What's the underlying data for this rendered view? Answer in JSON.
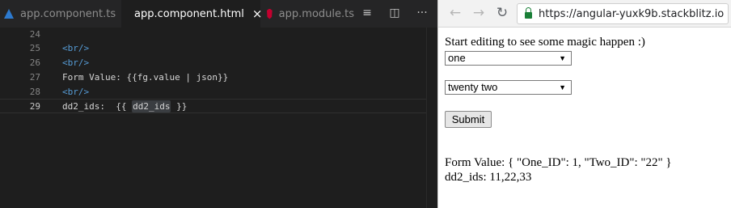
{
  "editor": {
    "tabs": [
      {
        "label": "app.component.ts",
        "icon": "typescript-icon"
      },
      {
        "label": "app.component.html",
        "icon": "html5-icon",
        "close": "×"
      },
      {
        "label": "app.module.ts",
        "icon": "angular-icon"
      }
    ],
    "toolbar": {
      "format_icon": "≡",
      "split_icon": "◫",
      "more_icon": "···"
    },
    "lines": [
      {
        "num": "24",
        "text": ""
      },
      {
        "num": "25",
        "text": "<br/>"
      },
      {
        "num": "26",
        "text": "<br/>"
      },
      {
        "num": "27",
        "text": "Form Value: {{fg.value | json}}"
      },
      {
        "num": "28",
        "text": "<br/>"
      },
      {
        "num": "29",
        "text_a": "dd2_ids:  {{ ",
        "text_hl": "dd2_ids",
        "text_b": " }}"
      }
    ]
  },
  "browser": {
    "url": "https://angular-yuxk9b.stackblitz.io",
    "back_icon": "←",
    "forward_icon": "→",
    "reload_icon": "↻",
    "heading": "Start editing to see some magic happen :)",
    "select1_value": "one",
    "select2_value": "twenty two",
    "select_arrow": "▼",
    "submit_label": "Submit",
    "form_value_text": "Form Value: { \"One_ID\": 1, \"Two_ID\": \"22\" }",
    "dd2_ids_text": "dd2_ids: 11,22,33"
  }
}
